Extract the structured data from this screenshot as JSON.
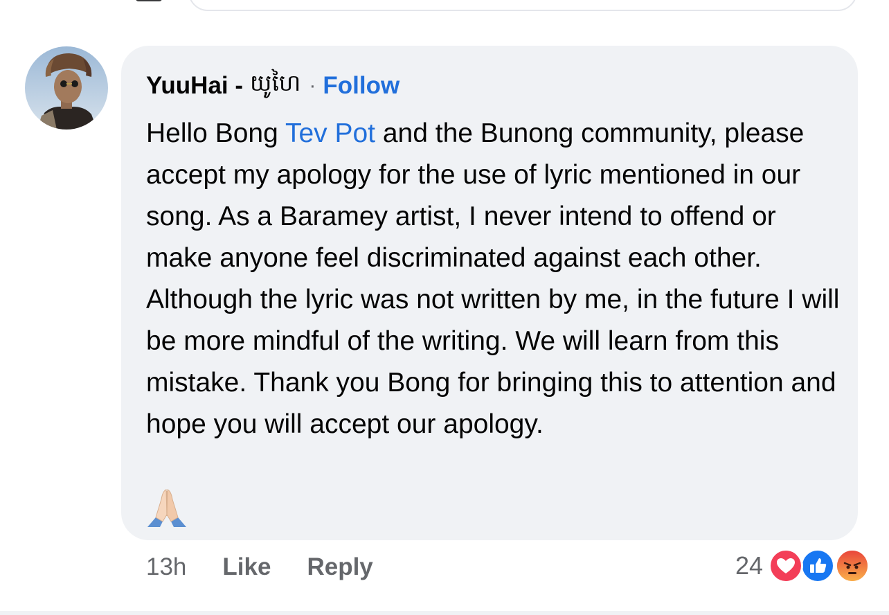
{
  "comment": {
    "author": "YuuHai -",
    "author_khmer": "យូហៃ",
    "separator": "·",
    "follow_label": "Follow",
    "text_before_mention": "Hello Bong ",
    "mention": "Tev Pot",
    "text_after_mention": " and the Bunong community, please accept my apology for the use of lyric mentioned in our song. As a Baramey artist, I never intend to offend or make anyone feel discriminated against each other. Although the lyric was not written by me, in the future I will be more mindful of the writing. We will learn from this mistake. Thank you Bong for bringing this to attention and hope you will accept our apology.",
    "emoji": "folded-hands-icon"
  },
  "actions": {
    "time": "13h",
    "like_label": "Like",
    "reply_label": "Reply"
  },
  "reactions": {
    "count": "24",
    "icons": [
      "love-reaction-icon",
      "like-reaction-icon",
      "angry-reaction-icon"
    ]
  },
  "colors": {
    "bubble": "#f0f2f5",
    "link": "#216fdb",
    "text": "#050505",
    "meta": "#65676b",
    "love": "#f33e58",
    "like": "#1877f2",
    "angry": "#f7714a"
  }
}
